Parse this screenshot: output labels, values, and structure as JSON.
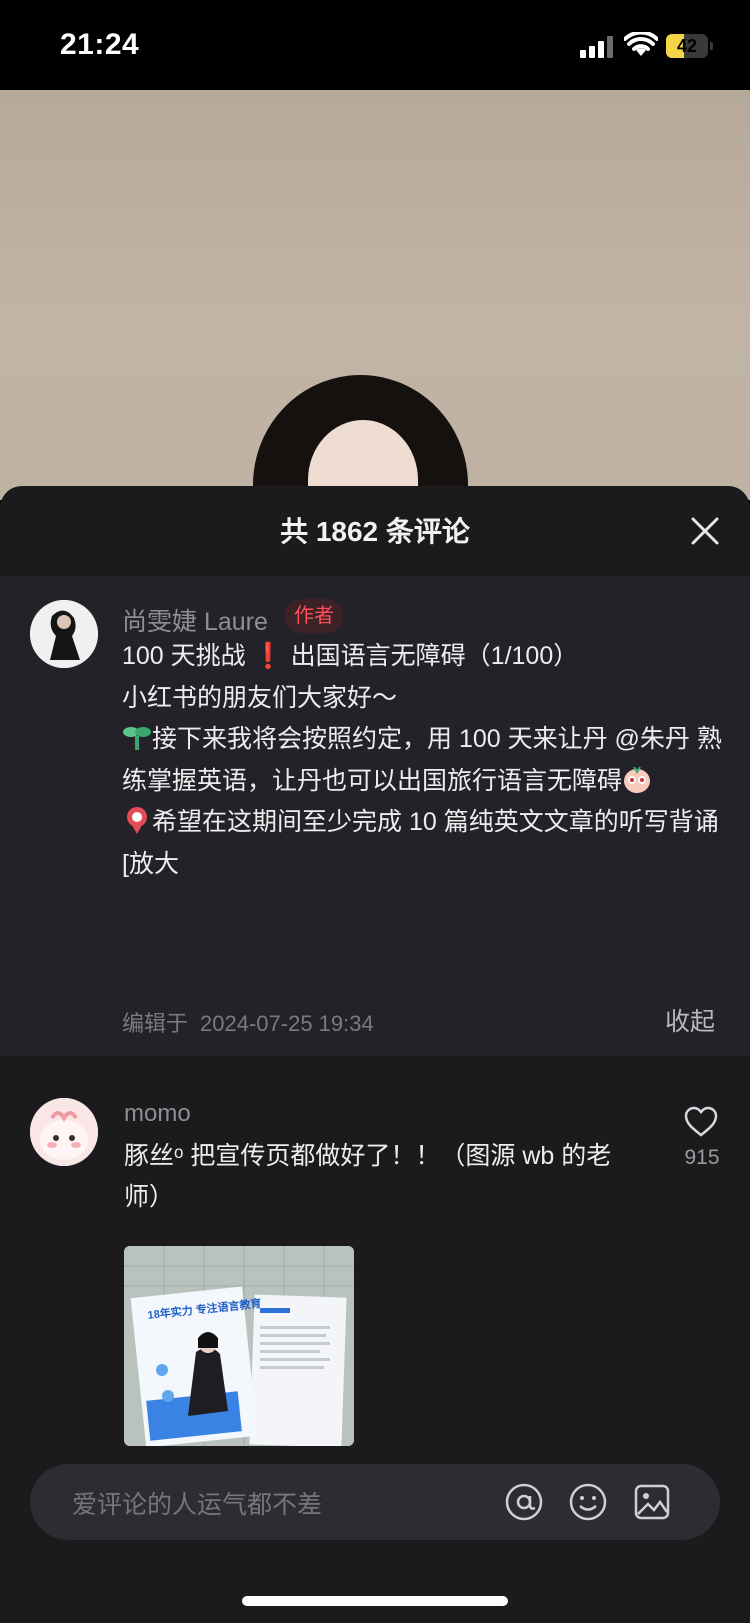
{
  "status_bar": {
    "time": "21:24",
    "battery": "42"
  },
  "sheet": {
    "title": "共 1862 条评论"
  },
  "author_comment": {
    "name": "尚雯婕 Laure",
    "tag": "作者",
    "lines": [
      "100 天挑战 ❗ 出国语言无障碍（1/100）",
      "小红书的朋友们大家好～",
      "接下来我将会按照约定，用 100 天来让丹 @朱丹 熟练掌握英语，让丹也可以出国旅行语言无障碍",
      "希望在这期间至少完成 10 篇纯英文文章的听写背诵",
      "[放大"
    ],
    "edited_label": "编辑于",
    "edited_time": "2024-07-25 19:34",
    "collapse_label": "收起"
  },
  "comment": {
    "user": "momo",
    "text": "豚丝ᵒ 把宣传页都做好了！！（图源 wb 的老师）",
    "likes": "915"
  },
  "image_text": {
    "headline": "18年实力 专注语言教育"
  },
  "input": {
    "placeholder": "爱评论的人运气都不差"
  },
  "colors": {
    "sheet": "#1b1b1e",
    "author_bg": "#222228",
    "tag": "#ff4d5a",
    "battery": "#f5d547"
  }
}
